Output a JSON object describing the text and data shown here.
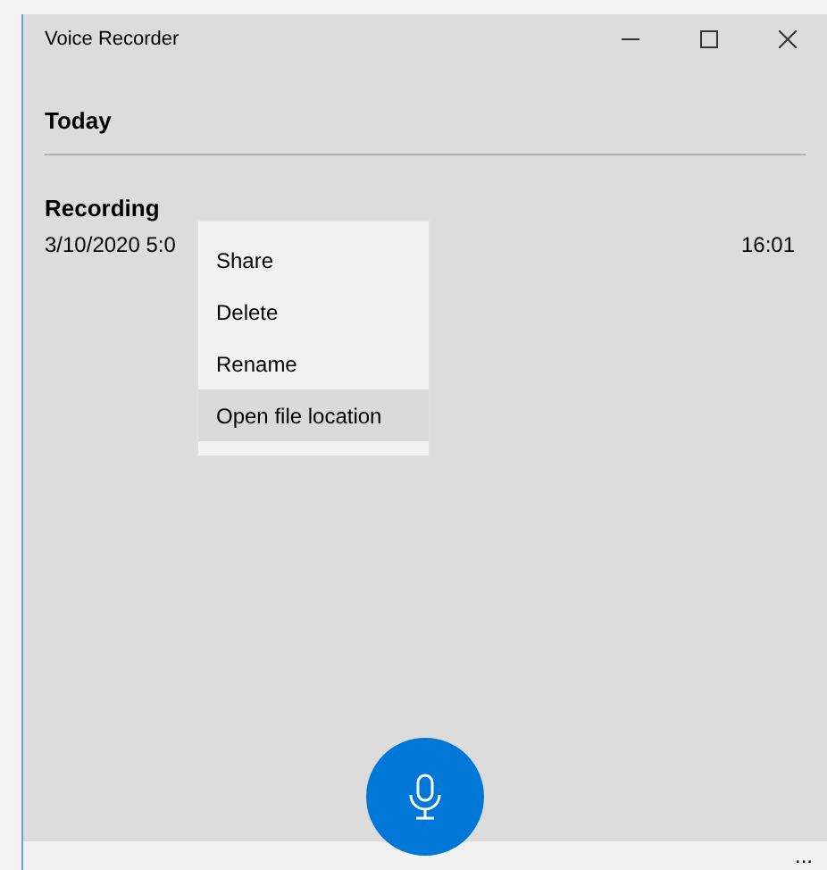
{
  "window": {
    "title": "Voice Recorder"
  },
  "section": {
    "title": "Today"
  },
  "recording": {
    "name": "Recording",
    "date": "3/10/2020 5:0",
    "duration": "16:01"
  },
  "context_menu": {
    "items": [
      {
        "label": "Share",
        "selected": false
      },
      {
        "label": "Delete",
        "selected": false
      },
      {
        "label": "Rename",
        "selected": false
      },
      {
        "label": "Open file location",
        "selected": true
      }
    ]
  },
  "bottom_bar": {
    "more": "..."
  }
}
